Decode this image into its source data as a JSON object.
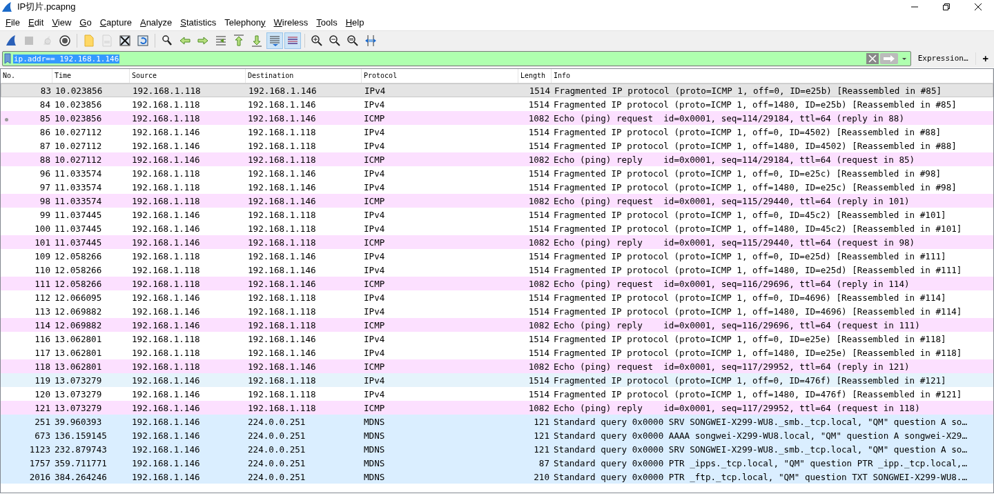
{
  "window": {
    "title": "IP切片.pcapng"
  },
  "menu": [
    {
      "accel": "F",
      "after": "ile"
    },
    {
      "accel": "E",
      "after": "dit"
    },
    {
      "accel": "V",
      "after": "iew"
    },
    {
      "accel": "G",
      "after": "o"
    },
    {
      "accel": "C",
      "after": "apture"
    },
    {
      "accel": "A",
      "after": "nalyze"
    },
    {
      "accel": "S",
      "after": "tatistics"
    },
    {
      "before": "Telephon",
      "accel": "y"
    },
    {
      "accel": "W",
      "after": "ireless"
    },
    {
      "accel": "T",
      "after": "ools"
    },
    {
      "accel": "H",
      "after": "elp"
    }
  ],
  "toolbar": [
    {
      "kind": "start",
      "disabled": false,
      "pressed": false
    },
    {
      "kind": "stop",
      "disabled": true,
      "pressed": false
    },
    {
      "kind": "restart",
      "disabled": true,
      "pressed": false
    },
    {
      "kind": "options",
      "disabled": false,
      "pressed": false
    },
    {
      "kind": "sep"
    },
    {
      "kind": "open",
      "disabled": false,
      "pressed": false
    },
    {
      "kind": "save",
      "disabled": true,
      "pressed": false
    },
    {
      "kind": "close",
      "disabled": false,
      "pressed": false
    },
    {
      "kind": "reload",
      "disabled": false,
      "pressed": false
    },
    {
      "kind": "sep"
    },
    {
      "kind": "find",
      "disabled": false,
      "pressed": false
    },
    {
      "kind": "back",
      "disabled": false,
      "pressed": false
    },
    {
      "kind": "forward",
      "disabled": false,
      "pressed": false
    },
    {
      "kind": "goto",
      "disabled": false,
      "pressed": false
    },
    {
      "kind": "first",
      "disabled": false,
      "pressed": false
    },
    {
      "kind": "last",
      "disabled": false,
      "pressed": false
    },
    {
      "kind": "autoscroll",
      "disabled": false,
      "pressed": true
    },
    {
      "kind": "colorize",
      "disabled": false,
      "pressed": true
    },
    {
      "kind": "sep"
    },
    {
      "kind": "zoomin",
      "disabled": false,
      "pressed": false
    },
    {
      "kind": "zoomout",
      "disabled": false,
      "pressed": false
    },
    {
      "kind": "zoomreset",
      "disabled": false,
      "pressed": false
    },
    {
      "kind": "resize",
      "disabled": false,
      "pressed": false
    }
  ],
  "filter": {
    "value": "ip.addr== 192.168.1.146",
    "valid": true,
    "text_selected": true,
    "expression_button": "Expression…",
    "add_button": "+"
  },
  "packet_list": {
    "columns": [
      {
        "label": "No."
      },
      {
        "label": "Time"
      },
      {
        "label": "Source"
      },
      {
        "label": "Destination"
      },
      {
        "label": "Protocol"
      },
      {
        "label": "Length"
      },
      {
        "label": "Info"
      }
    ],
    "rows": [
      {
        "no": "83",
        "time": "10.023856",
        "source": "192.168.1.118",
        "destination": "192.168.1.146",
        "protocol": "IPv4",
        "length": "1514",
        "info": "Fragmented IP protocol (proto=ICMP 1, off=0, ID=e25b) [Reassembled in #85]",
        "color": "#e4e4e4",
        "selected": true,
        "related": false
      },
      {
        "no": "84",
        "time": "10.023856",
        "source": "192.168.1.118",
        "destination": "192.168.1.146",
        "protocol": "IPv4",
        "length": "1514",
        "info": "Fragmented IP protocol (proto=ICMP 1, off=1480, ID=e25b) [Reassembled in #85]",
        "color": "#ffffff",
        "selected": false,
        "related": false
      },
      {
        "no": "85",
        "time": "10.023856",
        "source": "192.168.1.118",
        "destination": "192.168.1.146",
        "protocol": "ICMP",
        "length": "1082",
        "info": "Echo (ping) request  id=0x0001, seq=114/29184, ttl=64 (reply in 88)",
        "color": "#fce0ff",
        "selected": false,
        "related": true
      },
      {
        "no": "86",
        "time": "10.027112",
        "source": "192.168.1.146",
        "destination": "192.168.1.118",
        "protocol": "IPv4",
        "length": "1514",
        "info": "Fragmented IP protocol (proto=ICMP 1, off=0, ID=4502) [Reassembled in #88]",
        "color": "#ffffff",
        "selected": false,
        "related": false
      },
      {
        "no": "87",
        "time": "10.027112",
        "source": "192.168.1.146",
        "destination": "192.168.1.118",
        "protocol": "IPv4",
        "length": "1514",
        "info": "Fragmented IP protocol (proto=ICMP 1, off=1480, ID=4502) [Reassembled in #88]",
        "color": "#ffffff",
        "selected": false,
        "related": false
      },
      {
        "no": "88",
        "time": "10.027112",
        "source": "192.168.1.146",
        "destination": "192.168.1.118",
        "protocol": "ICMP",
        "length": "1082",
        "info": "Echo (ping) reply    id=0x0001, seq=114/29184, ttl=64 (request in 85)",
        "color": "#fce0ff",
        "selected": false,
        "related": false
      },
      {
        "no": "96",
        "time": "11.033574",
        "source": "192.168.1.118",
        "destination": "192.168.1.146",
        "protocol": "IPv4",
        "length": "1514",
        "info": "Fragmented IP protocol (proto=ICMP 1, off=0, ID=e25c) [Reassembled in #98]",
        "color": "#ffffff",
        "selected": false,
        "related": false
      },
      {
        "no": "97",
        "time": "11.033574",
        "source": "192.168.1.118",
        "destination": "192.168.1.146",
        "protocol": "IPv4",
        "length": "1514",
        "info": "Fragmented IP protocol (proto=ICMP 1, off=1480, ID=e25c) [Reassembled in #98]",
        "color": "#ffffff",
        "selected": false,
        "related": false
      },
      {
        "no": "98",
        "time": "11.033574",
        "source": "192.168.1.118",
        "destination": "192.168.1.146",
        "protocol": "ICMP",
        "length": "1082",
        "info": "Echo (ping) request  id=0x0001, seq=115/29440, ttl=64 (reply in 101)",
        "color": "#fce0ff",
        "selected": false,
        "related": false
      },
      {
        "no": "99",
        "time": "11.037445",
        "source": "192.168.1.146",
        "destination": "192.168.1.118",
        "protocol": "IPv4",
        "length": "1514",
        "info": "Fragmented IP protocol (proto=ICMP 1, off=0, ID=45c2) [Reassembled in #101]",
        "color": "#ffffff",
        "selected": false,
        "related": false
      },
      {
        "no": "100",
        "time": "11.037445",
        "source": "192.168.1.146",
        "destination": "192.168.1.118",
        "protocol": "IPv4",
        "length": "1514",
        "info": "Fragmented IP protocol (proto=ICMP 1, off=1480, ID=45c2) [Reassembled in #101]",
        "color": "#ffffff",
        "selected": false,
        "related": false
      },
      {
        "no": "101",
        "time": "11.037445",
        "source": "192.168.1.146",
        "destination": "192.168.1.118",
        "protocol": "ICMP",
        "length": "1082",
        "info": "Echo (ping) reply    id=0x0001, seq=115/29440, ttl=64 (request in 98)",
        "color": "#fce0ff",
        "selected": false,
        "related": false
      },
      {
        "no": "109",
        "time": "12.058266",
        "source": "192.168.1.118",
        "destination": "192.168.1.146",
        "protocol": "IPv4",
        "length": "1514",
        "info": "Fragmented IP protocol (proto=ICMP 1, off=0, ID=e25d) [Reassembled in #111]",
        "color": "#ffffff",
        "selected": false,
        "related": false
      },
      {
        "no": "110",
        "time": "12.058266",
        "source": "192.168.1.118",
        "destination": "192.168.1.146",
        "protocol": "IPv4",
        "length": "1514",
        "info": "Fragmented IP protocol (proto=ICMP 1, off=1480, ID=e25d) [Reassembled in #111]",
        "color": "#ffffff",
        "selected": false,
        "related": false
      },
      {
        "no": "111",
        "time": "12.058266",
        "source": "192.168.1.118",
        "destination": "192.168.1.146",
        "protocol": "ICMP",
        "length": "1082",
        "info": "Echo (ping) request  id=0x0001, seq=116/29696, ttl=64 (reply in 114)",
        "color": "#fce0ff",
        "selected": false,
        "related": false
      },
      {
        "no": "112",
        "time": "12.066095",
        "source": "192.168.1.146",
        "destination": "192.168.1.118",
        "protocol": "IPv4",
        "length": "1514",
        "info": "Fragmented IP protocol (proto=ICMP 1, off=0, ID=4696) [Reassembled in #114]",
        "color": "#ffffff",
        "selected": false,
        "related": false
      },
      {
        "no": "113",
        "time": "12.069882",
        "source": "192.168.1.146",
        "destination": "192.168.1.118",
        "protocol": "IPv4",
        "length": "1514",
        "info": "Fragmented IP protocol (proto=ICMP 1, off=1480, ID=4696) [Reassembled in #114]",
        "color": "#ffffff",
        "selected": false,
        "related": false
      },
      {
        "no": "114",
        "time": "12.069882",
        "source": "192.168.1.146",
        "destination": "192.168.1.118",
        "protocol": "ICMP",
        "length": "1082",
        "info": "Echo (ping) reply    id=0x0001, seq=116/29696, ttl=64 (request in 111)",
        "color": "#fce0ff",
        "selected": false,
        "related": false
      },
      {
        "no": "116",
        "time": "13.062801",
        "source": "192.168.1.118",
        "destination": "192.168.1.146",
        "protocol": "IPv4",
        "length": "1514",
        "info": "Fragmented IP protocol (proto=ICMP 1, off=0, ID=e25e) [Reassembled in #118]",
        "color": "#ffffff",
        "selected": false,
        "related": false
      },
      {
        "no": "117",
        "time": "13.062801",
        "source": "192.168.1.118",
        "destination": "192.168.1.146",
        "protocol": "IPv4",
        "length": "1514",
        "info": "Fragmented IP protocol (proto=ICMP 1, off=1480, ID=e25e) [Reassembled in #118]",
        "color": "#ffffff",
        "selected": false,
        "related": false
      },
      {
        "no": "118",
        "time": "13.062801",
        "source": "192.168.1.118",
        "destination": "192.168.1.146",
        "protocol": "ICMP",
        "length": "1082",
        "info": "Echo (ping) request  id=0x0001, seq=117/29952, ttl=64 (reply in 121)",
        "color": "#fce0ff",
        "selected": false,
        "related": false
      },
      {
        "no": "119",
        "time": "13.073279",
        "source": "192.168.1.146",
        "destination": "192.168.1.118",
        "protocol": "IPv4",
        "length": "1514",
        "info": "Fragmented IP protocol (proto=ICMP 1, off=0, ID=476f) [Reassembled in #121]",
        "color": "#e5f3fb",
        "selected": false,
        "related": false
      },
      {
        "no": "120",
        "time": "13.073279",
        "source": "192.168.1.146",
        "destination": "192.168.1.118",
        "protocol": "IPv4",
        "length": "1514",
        "info": "Fragmented IP protocol (proto=ICMP 1, off=1480, ID=476f) [Reassembled in #121]",
        "color": "#ffffff",
        "selected": false,
        "related": false
      },
      {
        "no": "121",
        "time": "13.073279",
        "source": "192.168.1.146",
        "destination": "192.168.1.118",
        "protocol": "ICMP",
        "length": "1082",
        "info": "Echo (ping) reply    id=0x0001, seq=117/29952, ttl=64 (request in 118)",
        "color": "#fce0ff",
        "selected": false,
        "related": false
      },
      {
        "no": "251",
        "time": "39.960393",
        "source": "192.168.1.146",
        "destination": "224.0.0.251",
        "protocol": "MDNS",
        "length": "121",
        "info": "Standard query 0x0000 SRV SONGWEI-X299-WU8._smb._tcp.local, \"QM\" question A so…",
        "color": "#daeeff",
        "selected": false,
        "related": false
      },
      {
        "no": "673",
        "time": "136.159145",
        "source": "192.168.1.146",
        "destination": "224.0.0.251",
        "protocol": "MDNS",
        "length": "121",
        "info": "Standard query 0x0000 AAAA songwei-X299-WU8.local, \"QM\" question A songwei-X29…",
        "color": "#daeeff",
        "selected": false,
        "related": false
      },
      {
        "no": "1123",
        "time": "232.879743",
        "source": "192.168.1.146",
        "destination": "224.0.0.251",
        "protocol": "MDNS",
        "length": "121",
        "info": "Standard query 0x0000 SRV SONGWEI-X299-WU8._smb._tcp.local, \"QM\" question A so…",
        "color": "#daeeff",
        "selected": false,
        "related": false
      },
      {
        "no": "1757",
        "time": "359.711771",
        "source": "192.168.1.146",
        "destination": "224.0.0.251",
        "protocol": "MDNS",
        "length": "87",
        "info": "Standard query 0x0000 PTR _ipps._tcp.local, \"QM\" question PTR _ipp._tcp.local,…",
        "color": "#daeeff",
        "selected": false,
        "related": false
      },
      {
        "no": "2016",
        "time": "384.264246",
        "source": "192.168.1.146",
        "destination": "224.0.0.251",
        "protocol": "MDNS",
        "length": "210",
        "info": "Standard query 0x0000 PTR _ftp._tcp.local, \"QM\" question TXT SONGWEI-X299-WU8.…",
        "color": "#daeeff",
        "selected": false,
        "related": false
      }
    ]
  }
}
